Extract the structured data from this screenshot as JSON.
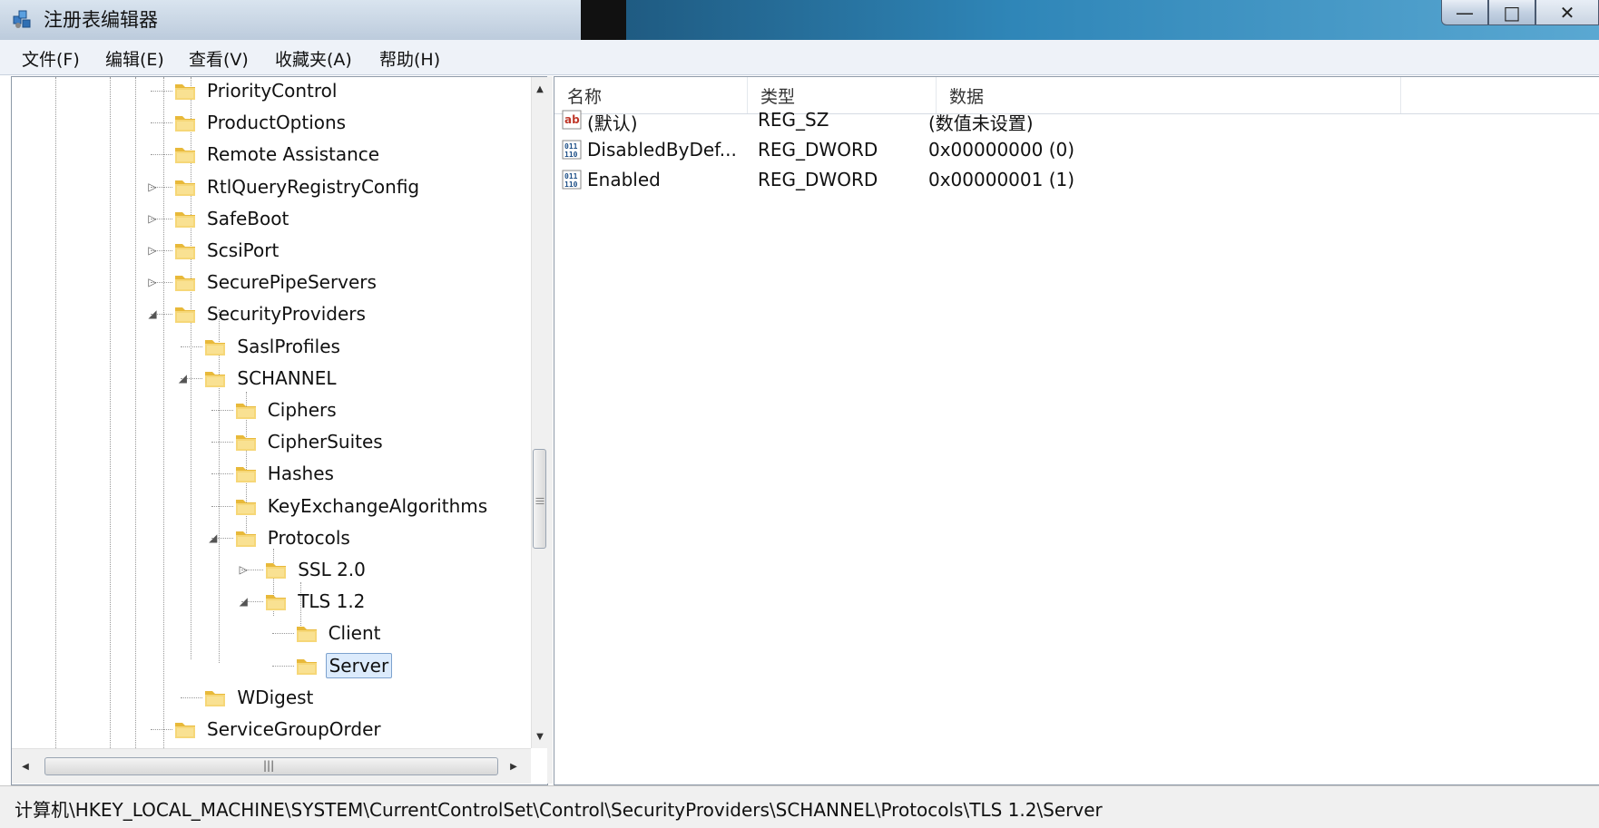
{
  "window": {
    "title": "注册表编辑器"
  },
  "menu": [
    "文件(F)",
    "编辑(E)",
    "查看(V)",
    "收藏夹(A)",
    "帮助(H)"
  ],
  "tree": [
    {
      "label": "PriorityControl",
      "level": 0,
      "expander": ""
    },
    {
      "label": "ProductOptions",
      "level": 0,
      "expander": ""
    },
    {
      "label": "Remote Assistance",
      "level": 0,
      "expander": ""
    },
    {
      "label": "RtlQueryRegistryConfig",
      "level": 0,
      "expander": "collapsed"
    },
    {
      "label": "SafeBoot",
      "level": 0,
      "expander": "collapsed"
    },
    {
      "label": "ScsiPort",
      "level": 0,
      "expander": "collapsed"
    },
    {
      "label": "SecurePipeServers",
      "level": 0,
      "expander": "collapsed"
    },
    {
      "label": "SecurityProviders",
      "level": 0,
      "expander": "expanded"
    },
    {
      "label": "SaslProfiles",
      "level": 1,
      "expander": ""
    },
    {
      "label": "SCHANNEL",
      "level": 1,
      "expander": "expanded"
    },
    {
      "label": "Ciphers",
      "level": 2,
      "expander": ""
    },
    {
      "label": "CipherSuites",
      "level": 2,
      "expander": ""
    },
    {
      "label": "Hashes",
      "level": 2,
      "expander": ""
    },
    {
      "label": "KeyExchangeAlgorithms",
      "level": 2,
      "expander": ""
    },
    {
      "label": "Protocols",
      "level": 2,
      "expander": "expanded"
    },
    {
      "label": "SSL 2.0",
      "level": 3,
      "expander": "collapsed"
    },
    {
      "label": "TLS 1.2",
      "level": 3,
      "expander": "expanded"
    },
    {
      "label": "Client",
      "level": 4,
      "expander": ""
    },
    {
      "label": "Server",
      "level": 4,
      "expander": "",
      "selected": true
    },
    {
      "label": "WDigest",
      "level": 1,
      "expander": ""
    },
    {
      "label": "ServiceGroupOrder",
      "level": 0,
      "expander": ""
    }
  ],
  "list": {
    "columns": [
      "名称",
      "类型",
      "数据"
    ],
    "rows": [
      {
        "icon": "string-value-icon",
        "name": "(默认)",
        "type": "REG_SZ",
        "data": "(数值未设置)"
      },
      {
        "icon": "dword-value-icon",
        "name": "DisabledByDef...",
        "type": "REG_DWORD",
        "data": "0x00000000 (0)"
      },
      {
        "icon": "dword-value-icon",
        "name": "Enabled",
        "type": "REG_DWORD",
        "data": "0x00000001 (1)"
      }
    ]
  },
  "status": {
    "path": "计算机\\HKEY_LOCAL_MACHINE\\SYSTEM\\CurrentControlSet\\Control\\SecurityProviders\\SCHANNEL\\Protocols\\TLS 1.2\\Server"
  },
  "colors": {
    "selection": "#dcebfc",
    "selection_border": "#7da2ce",
    "folder": "#f2c94c"
  }
}
